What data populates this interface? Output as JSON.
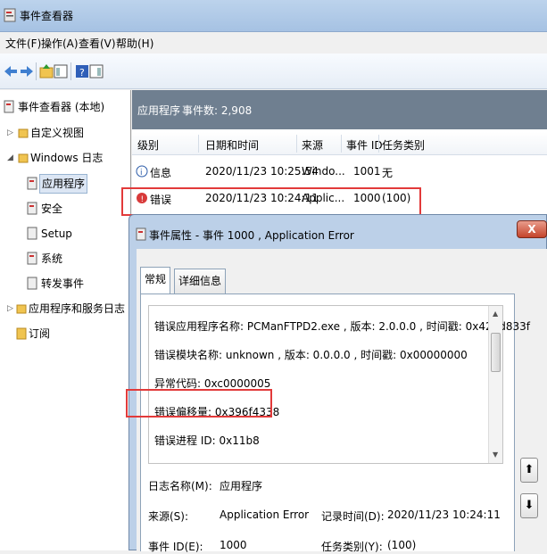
{
  "window": {
    "title": "事件查看器"
  },
  "menu": [
    "文件(F)",
    "操作(A)",
    "查看(V)",
    "帮助(H)"
  ],
  "tree": {
    "root": "事件查看器 (本地)",
    "custom_views": "自定义视图",
    "windows_logs": "Windows 日志",
    "application": "应用程序",
    "security": "安全",
    "setup": "Setup",
    "system": "系统",
    "forwarded": "转发事件",
    "app_service_logs": "应用程序和服务日志",
    "subscriptions": "订阅"
  },
  "pane_header": {
    "name": "应用程序",
    "count": "事件数: 2,908"
  },
  "columns": {
    "level": "级别",
    "datetime": "日期和时间",
    "source": "来源",
    "event_id": "事件 ID",
    "task": "任务类别"
  },
  "events": [
    {
      "level": "信息",
      "datetime": "2020/11/23 10:25:54",
      "source": "Windo...",
      "event_id": "1001",
      "task": "无"
    },
    {
      "level": "错误",
      "datetime": "2020/11/23 10:24:11",
      "source": "Applic...",
      "event_id": "1000",
      "task": "(100)"
    }
  ],
  "dialog": {
    "title": "事件属性 - 事件 1000 , Application Error",
    "close": "X",
    "tabs": [
      "常规",
      "详细信息"
    ],
    "details": [
      "错误应用程序名称: PCManFTPD2.exe , 版本: 2.0.0.0 , 时间戳: 0x425d833f",
      "错误模块名称: unknown , 版本: 0.0.0.0 , 时间戳: 0x00000000",
      "异常代码: 0xc0000005",
      "错误偏移量: 0x396f4338",
      "错误进程 ID: 0x11b8"
    ],
    "log_name_label": "日志名称(M):",
    "log_name_value": "应用程序",
    "source_label": "来源(S):",
    "source_value": "Application Error",
    "logged_label": "记录时间(D):",
    "logged_value": "2020/11/23 10:24:11",
    "event_id_label": "事件 ID(E):",
    "event_id_value": "1000",
    "task_label": "任务类别(Y):",
    "task_value": "(100)"
  }
}
